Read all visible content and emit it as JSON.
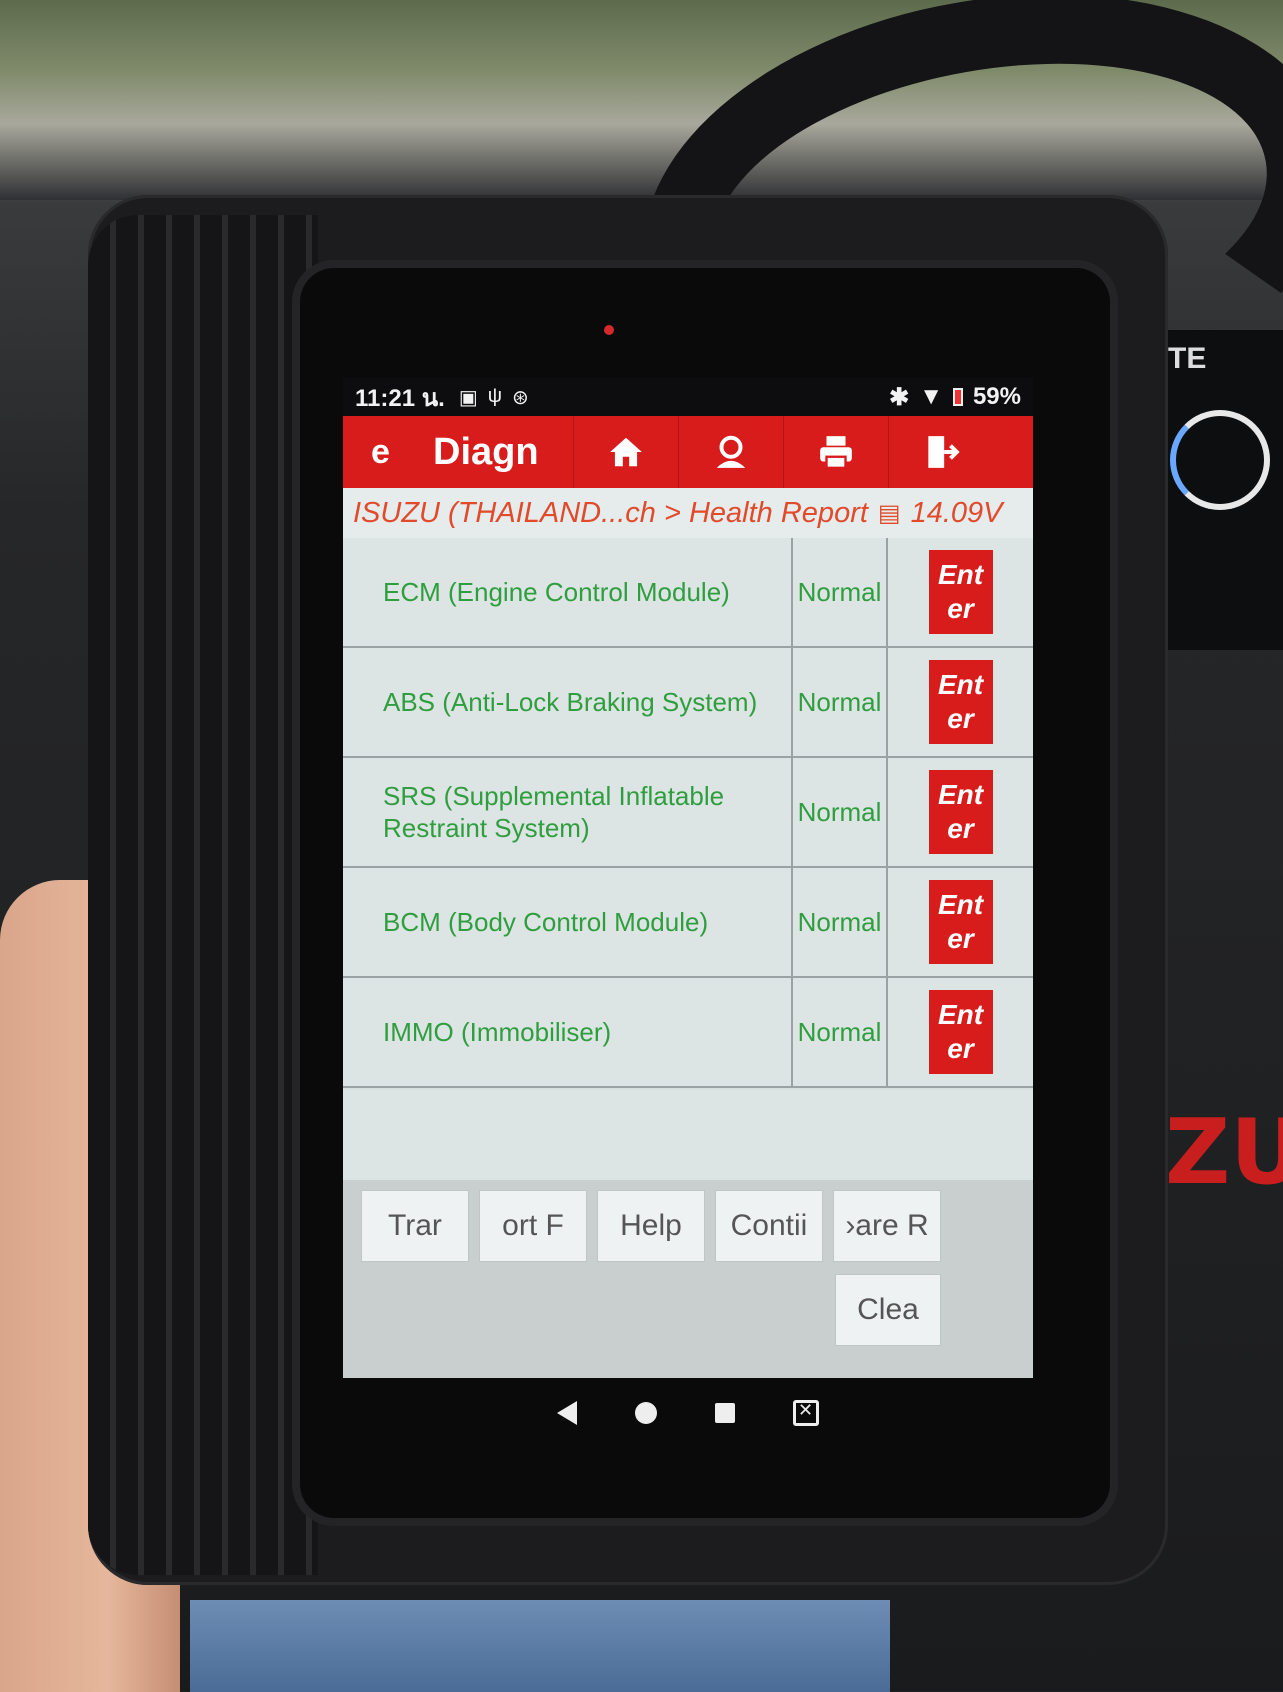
{
  "status_bar": {
    "time": "11:21 น.",
    "left_icons": [
      "calendar-icon",
      "usb-icon",
      "sync-icon"
    ],
    "bluetooth_glyph": "✱",
    "wifi_glyph": "▼",
    "battery": "59%"
  },
  "app_bar": {
    "left_text": "e",
    "title": "Diagn",
    "buttons": [
      "home-icon",
      "user-icon",
      "print-icon",
      "exit-icon"
    ]
  },
  "breadcrumb": {
    "path": "ISUZU (THAILAND...ch > Health Report",
    "voltage": "14.09V"
  },
  "modules": [
    {
      "name": "ECM (Engine Control Module)",
      "status": "Normal",
      "action": "Ent\ner"
    },
    {
      "name": "ABS (Anti-Lock Braking System)",
      "status": "Normal",
      "action": "Ent\ner"
    },
    {
      "name": "SRS (Supplemental Inflatable Restraint System)",
      "status": "Normal",
      "action": "Ent\ner"
    },
    {
      "name": "BCM (Body Control Module)",
      "status": "Normal",
      "action": "Ent\ner"
    },
    {
      "name": "IMMO (Immobiliser)",
      "status": "Normal",
      "action": "Ent\ner"
    }
  ],
  "bottom_buttons": {
    "b1": "Trar",
    "b2": "ort  F",
    "b3": "Help",
    "b4": "Contii",
    "b5": "›are R",
    "b6": "Clea"
  },
  "background": {
    "dash_label": "TE",
    "logo_text": "ZU"
  },
  "colors": {
    "accent": "#d81c1c",
    "ok_text": "#2f9e3f",
    "breadcrumb": "#e14a2a"
  }
}
